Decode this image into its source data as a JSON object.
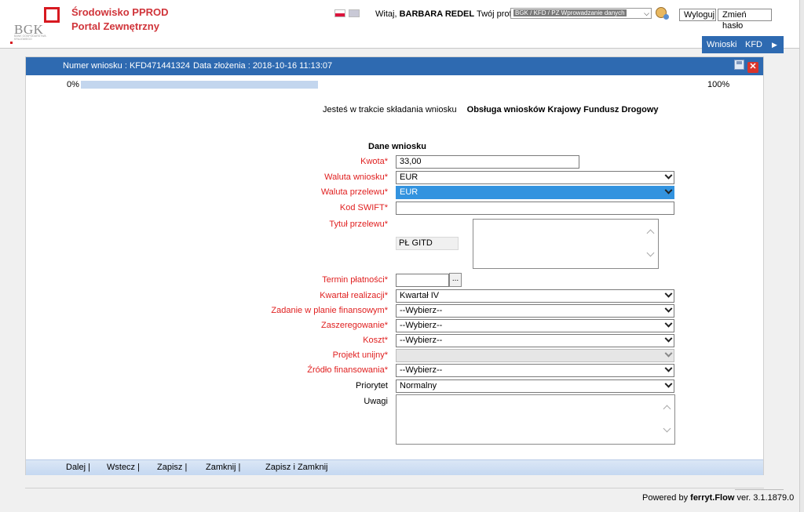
{
  "header": {
    "logo_text": "BGK",
    "logo_subtext": "BANK GOSPODARSTWA KRAJOWEGO",
    "portal_name_line1": "Środowisko PPROD",
    "portal_name_line2": "Portal Zewnętrzny",
    "welcome_prefix": "Witaj,",
    "user_name": "BARBARA REDEL",
    "profile_label": "Twój profil:",
    "profile_value": "BGK / KFD / PZ Wprowadzanie danych",
    "logout_label": "Wyloguj",
    "change_password_label": "Zmień hasło",
    "tabs": [
      "Wnioski",
      "KFD"
    ],
    "tab_arrow": "▶"
  },
  "request": {
    "number_text": "Numer wniosku : KFD471441324",
    "date_text": "Data złożenia : 2018-10-16 11:13:07"
  },
  "progress": {
    "start_label": "0%",
    "end_label": "100%",
    "fraction": 0.38
  },
  "process": {
    "prefix": "Jesteś w trakcie składania wniosku",
    "name": "Obsługa wniosków Krajowy Fundusz Drogowy"
  },
  "form": {
    "section_title": "Dane wniosku",
    "kwota_label": "Kwota*",
    "kwota_value": "33,00",
    "waluta_wniosku_label": "Waluta wniosku*",
    "waluta_wniosku_value": "EUR",
    "waluta_przelewu_label": "Waluta przelewu*",
    "waluta_przelewu_value": "EUR",
    "kod_swift_label": "Kod SWIFT*",
    "kod_swift_value": "",
    "tytul_label": "Tytuł przelewu*",
    "tytul_prefix": "PŁ GITD",
    "termin_label": "Termin płatności*",
    "termin_button": "...",
    "kwartal_label": "Kwartał realizacji*",
    "kwartal_value": "Kwartał IV",
    "zadanie_label": "Zadanie w planie finansowym*",
    "zadanie_value": "--Wybierz--",
    "zaszeregowanie_label": "Zaszeregowanie*",
    "zaszeregowanie_value": "--Wybierz--",
    "koszt_label": "Koszt*",
    "koszt_value": "--Wybierz--",
    "projekt_label": "Projekt unijny*",
    "projekt_value": "",
    "zrodlo_label": "Źródło finansowania*",
    "zrodlo_value": "--Wybierz--",
    "priorytet_label": "Priorytet",
    "priorytet_value": "Normalny",
    "uwagi_label": "Uwagi"
  },
  "actions": {
    "next": "Dalej |",
    "back": "Wstecz |",
    "save": "Zapisz |",
    "close": "Zamknij |",
    "save_close": "Zapisz i Zamknij"
  },
  "footer": {
    "prefix": "Powered by",
    "brand": "ferryt.Flow",
    "version": "ver. 3.1.1879.0"
  },
  "colors": {
    "accent": "#2e6ab1",
    "required_label": "#e02020",
    "brand_red": "#d0343a",
    "selected_field": "#3393df"
  }
}
